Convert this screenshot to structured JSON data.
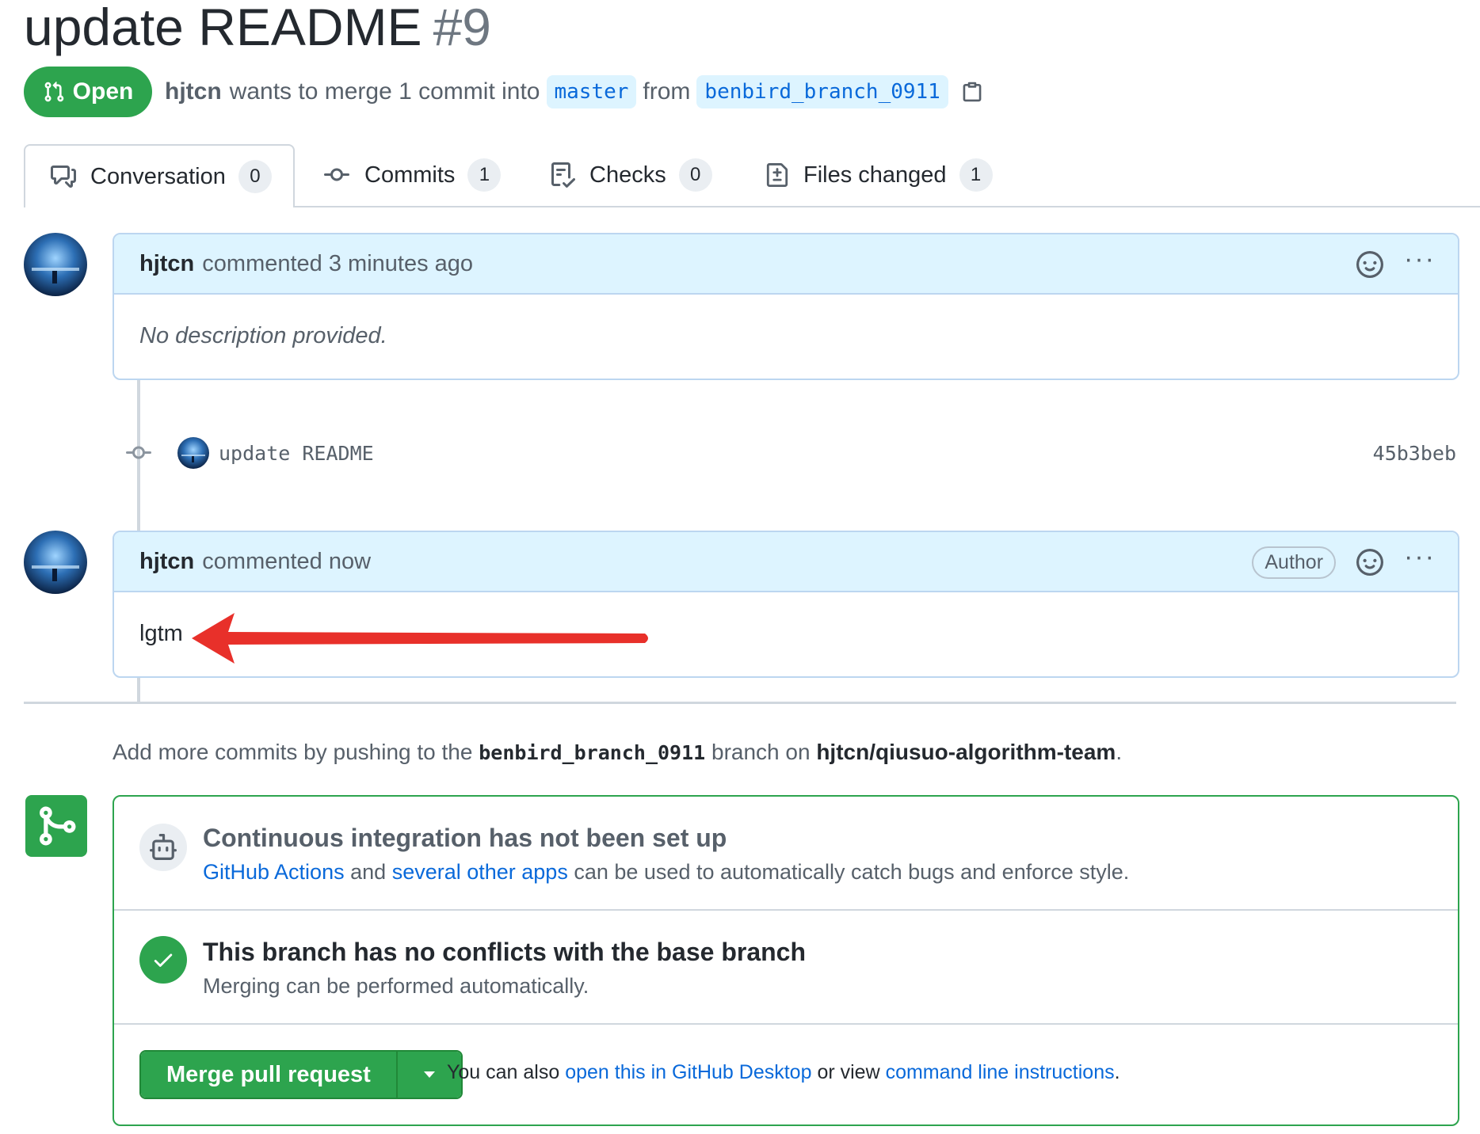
{
  "pr": {
    "title": "update README",
    "number": "#9",
    "state": "Open",
    "author": "hjtcn",
    "summary": "wants to merge 1 commit into",
    "base_branch": "master",
    "from_word": "from",
    "head_branch": "benbird_branch_0911"
  },
  "tabs": [
    {
      "label": "Conversation",
      "count": "0",
      "icon": "comment-discussion-icon"
    },
    {
      "label": "Commits",
      "count": "1",
      "icon": "git-commit-icon"
    },
    {
      "label": "Checks",
      "count": "0",
      "icon": "checklist-icon"
    },
    {
      "label": "Files changed",
      "count": "1",
      "icon": "file-diff-icon"
    }
  ],
  "timeline": {
    "comment1": {
      "author": "hjtcn",
      "meta": "commented 3 minutes ago",
      "body": "No description provided."
    },
    "commit": {
      "message": "update README",
      "sha": "45b3beb"
    },
    "comment2": {
      "author": "hjtcn",
      "meta": "commented now",
      "badge": "Author",
      "body": "lgtm"
    }
  },
  "hint": {
    "prefix": "Add more commits by pushing to the",
    "branch": "benbird_branch_0911",
    "middle": "branch on",
    "repo": "hjtcn/qiusuo-algorithm-team",
    "suffix": "."
  },
  "merge_box": {
    "ci": {
      "title": "Continuous integration has not been set up",
      "link1": "GitHub Actions",
      "and": "and",
      "link2": "several other apps",
      "rest": "can be used to automatically catch bugs and enforce style."
    },
    "conflicts": {
      "title": "This branch has no conflicts with the base branch",
      "sub": "Merging can be performed automatically."
    },
    "merge": {
      "button": "Merge pull request",
      "alt_prefix": "You can also",
      "alt_link1": "open this in GitHub Desktop",
      "alt_middle": "or view",
      "alt_link2": "command line instructions",
      "alt_suffix": "."
    }
  },
  "colors": {
    "green": "#2da44e",
    "link": "#0969da",
    "annotation": "#e8302a"
  }
}
